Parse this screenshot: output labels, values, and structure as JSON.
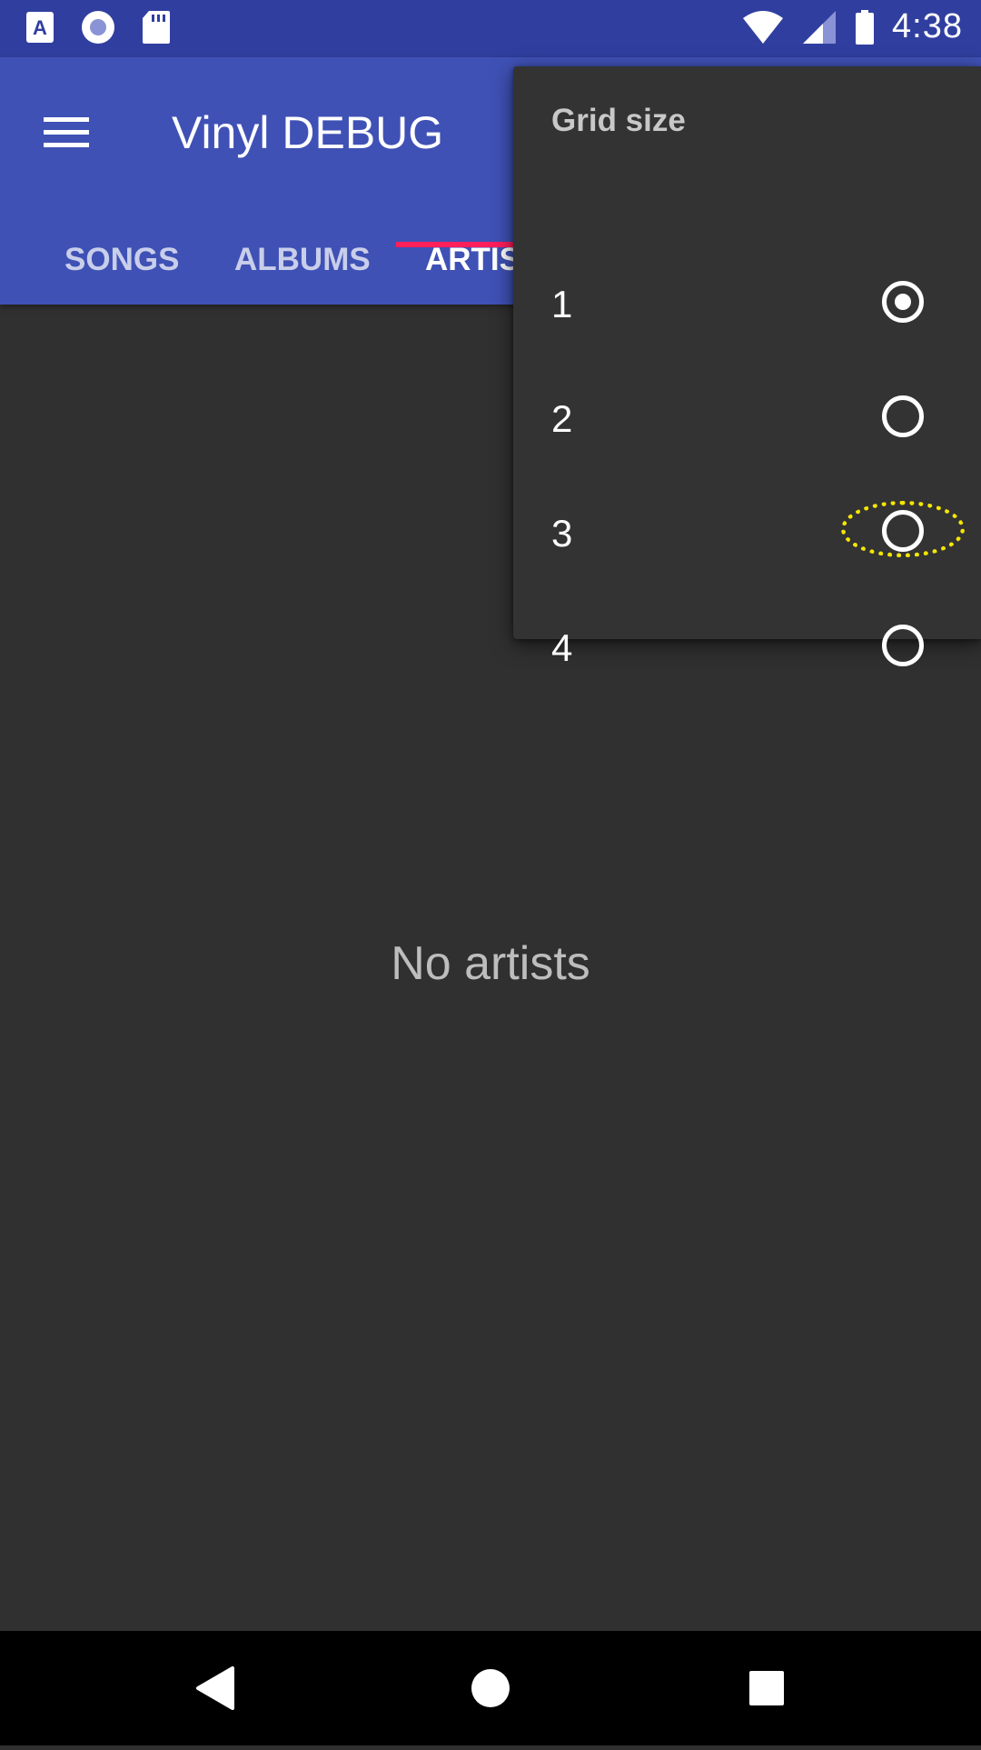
{
  "status_bar": {
    "time": "4:38",
    "left_icons": [
      "accessibility-icon",
      "record-icon",
      "sd-card-icon"
    ],
    "right_icons": [
      "wifi-icon",
      "signal-icon",
      "battery-icon"
    ]
  },
  "app_bar": {
    "title": "Vinyl DEBUG",
    "tabs": [
      {
        "label": "SONGS"
      },
      {
        "label": "ALBUMS"
      },
      {
        "label": "ARTISTS"
      }
    ],
    "active_tab": "ARTISTS",
    "indicator_color": "#ff1f5a",
    "background_color": "#3f51b5"
  },
  "empty_state": {
    "text": "No artists"
  },
  "grid_menu": {
    "title": "Grid size",
    "options": [
      {
        "label": "1",
        "checked": true
      },
      {
        "label": "2",
        "checked": false
      },
      {
        "label": "3",
        "checked": false
      },
      {
        "label": "4",
        "checked": false
      }
    ],
    "highlight_color": "#f5e600"
  },
  "nav_bar": {
    "buttons": [
      "back-icon",
      "home-icon",
      "recents-icon"
    ]
  }
}
